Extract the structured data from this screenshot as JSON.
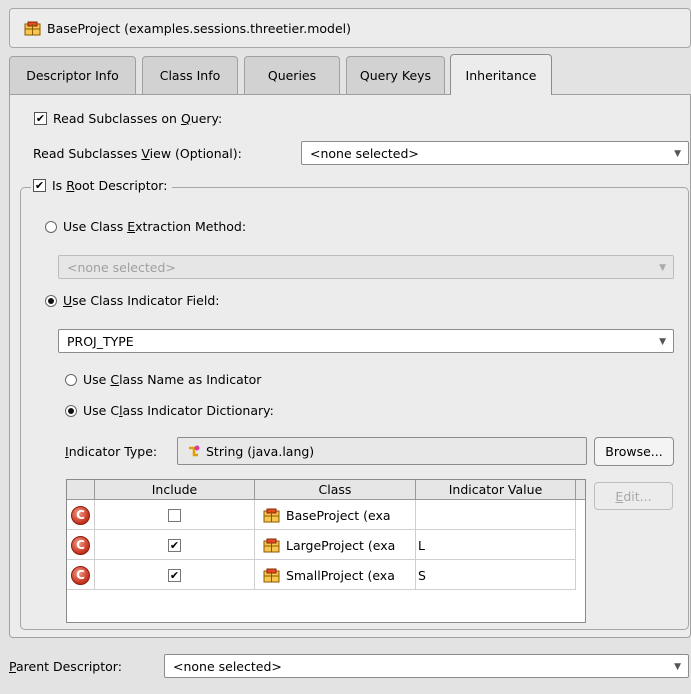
{
  "title": "BaseProject (examples.sessions.threetier.model)",
  "tabs": [
    {
      "label": "Descriptor Info"
    },
    {
      "label": "Class Info"
    },
    {
      "label": "Queries"
    },
    {
      "label": "Query Keys"
    },
    {
      "label": "Inheritance",
      "active": true
    }
  ],
  "read_subclasses": {
    "label_pre": "Read Subclasses on ",
    "label_mnemonic": "Q",
    "label_post": "uery:",
    "checked": true
  },
  "read_subclasses_view": {
    "label_pre": "Read Subclasses ",
    "label_mnemonic": "V",
    "label_post": "iew (Optional):",
    "value": "<none selected>"
  },
  "is_root": {
    "label_pre": "Is ",
    "label_mnemonic": "R",
    "label_post": "oot Descriptor:",
    "checked": true
  },
  "extraction": {
    "label_pre": "Use Class ",
    "label_mnemonic": "E",
    "label_post": "xtraction Method:",
    "selected": false,
    "value": "<none selected>"
  },
  "indicator_field": {
    "label_pre": "",
    "label_mnemonic": "U",
    "label_post": "se Class Indicator Field:",
    "selected": true,
    "value": "PROJ_TYPE"
  },
  "class_name_indicator": {
    "label_pre": "Use ",
    "label_mnemonic": "C",
    "label_post": "lass Name as Indicator",
    "selected": false
  },
  "indicator_dictionary": {
    "label_pre": "Use C",
    "label_mnemonic": "l",
    "label_post": "ass Indicator Dictionary:",
    "selected": true
  },
  "indicator_type": {
    "label_pre": "",
    "label_mnemonic": "I",
    "label_post": "ndicator Type:",
    "value": "String (java.lang)"
  },
  "browse_label": "Browse...",
  "edit": {
    "label_pre": "",
    "label_mnemonic": "E",
    "label_post": "dit..."
  },
  "table": {
    "columns": [
      "Include",
      "Class",
      "Indicator Value"
    ],
    "rows": [
      {
        "icon": "C",
        "include": false,
        "class": "BaseProject (exa",
        "indicator": ""
      },
      {
        "icon": "C",
        "include": true,
        "class": "LargeProject (exa",
        "indicator": "L"
      },
      {
        "icon": "C",
        "include": true,
        "class": "SmallProject (exa",
        "indicator": "S"
      }
    ]
  },
  "parent": {
    "label_pre": "",
    "label_mnemonic": "P",
    "label_post": "arent Descriptor:",
    "value": "<none selected>"
  }
}
